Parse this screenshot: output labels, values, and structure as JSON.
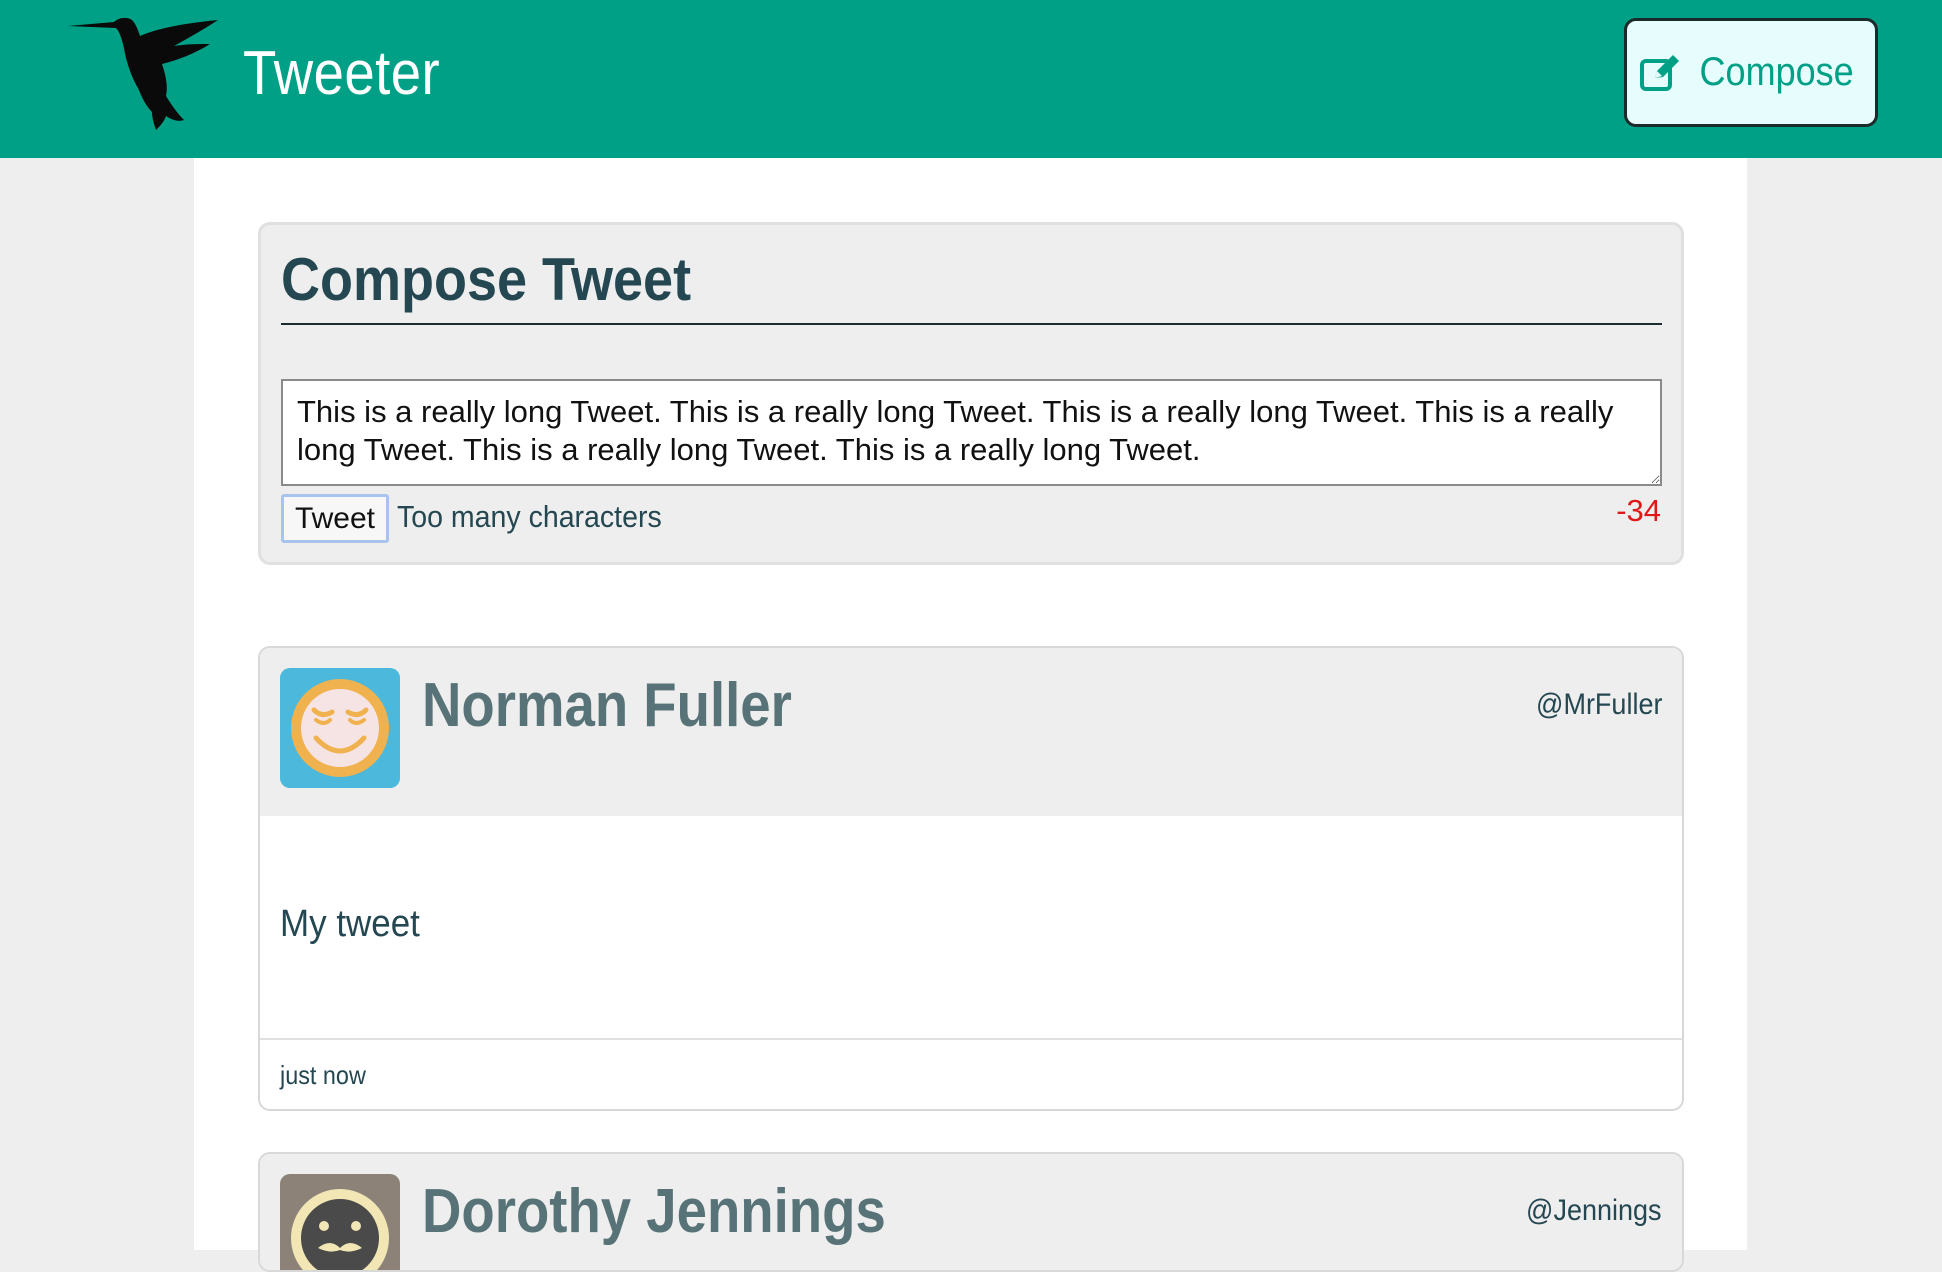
{
  "header": {
    "brand": "Tweeter",
    "logo_icon": "hummingbird-icon",
    "compose_button": {
      "label": "Compose",
      "icon": "edit-icon"
    },
    "colors": {
      "bar": "#00a087",
      "compose_bg": "#e7fcfd",
      "compose_text": "#00a087"
    }
  },
  "compose": {
    "title": "Compose Tweet",
    "textarea_value": "This is a really long Tweet. This is a really long Tweet. This is a really long Tweet. This is a really long Tweet. This is a really long Tweet. This is a really long Tweet.",
    "submit_label": "Tweet",
    "error_message": "Too many characters",
    "counter": "-34",
    "counter_color": "#e01818"
  },
  "tweets": [
    {
      "name": "Norman Fuller",
      "handle": "@MrFuller",
      "content": "My tweet",
      "timestamp": "just now",
      "avatar_icon": "smiley-avatar-icon",
      "avatar_bg": "#4bb8dc"
    },
    {
      "name": "Dorothy Jennings",
      "handle": "@Jennings",
      "avatar_icon": "mustache-avatar-icon",
      "avatar_bg": "#8c8278"
    }
  ]
}
